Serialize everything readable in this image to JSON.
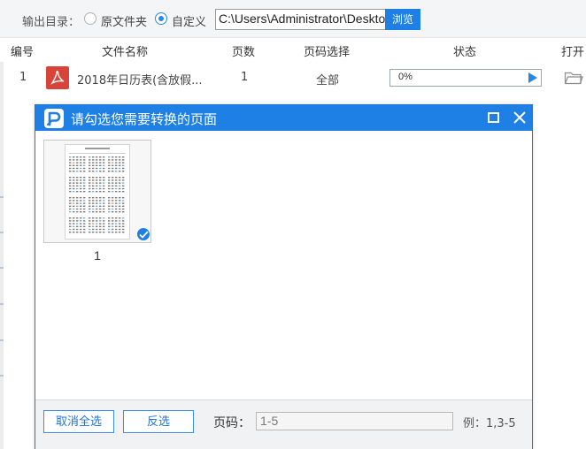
{
  "output": {
    "label": "输出目录：",
    "option_original": "原文件夹",
    "option_custom": "自定义",
    "selected": "custom",
    "path": "C:\\Users\\Administrator\\Deskto",
    "browse_label": "浏览"
  },
  "table": {
    "headers": [
      "编号",
      "文件名称",
      "页数",
      "页码选择",
      "状态",
      "打开"
    ],
    "rows": [
      {
        "index": "1",
        "file_name": "2018年日历表(含放假...",
        "pages": "1",
        "page_select": "全部",
        "progress": "0%",
        "progress_value": 0,
        "file_icon": "pdf-icon",
        "open_icon": "folder-icon"
      }
    ]
  },
  "dialog": {
    "title": "请勾选您需要转换的页面",
    "logo_icon": "app-logo-icon",
    "thumbnails": [
      {
        "label": "1",
        "checked": true
      }
    ],
    "deselect_all_label": "取消全选",
    "invert_label": "反选",
    "page_label": "页码：",
    "page_value": "1-5",
    "example_text": "例：1,3-5"
  },
  "colors": {
    "accent": "#1e80e5",
    "pdf_red": "#d9443a",
    "progress_blue": "#4da3f0"
  }
}
